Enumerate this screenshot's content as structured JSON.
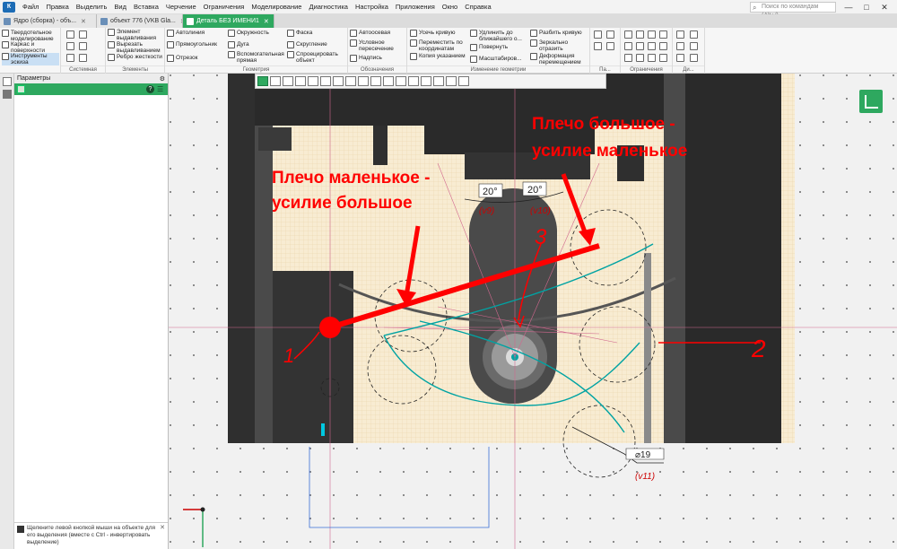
{
  "menubar": {
    "logo": "К",
    "items": [
      "Файл",
      "Правка",
      "Выделить",
      "Вид",
      "Вставка",
      "Черчение",
      "Ограничения",
      "Моделирование",
      "Диагностика",
      "Настройка",
      "Приложения",
      "Окно",
      "Справка"
    ],
    "search_placeholder": "Поиск по командам (Alt+/)",
    "window_buttons": [
      "—",
      "□",
      "✕"
    ]
  },
  "tabs": [
    {
      "label": "Ядро (сборка) - объ...",
      "close": "✕",
      "active": false
    },
    {
      "label": "объект 776 (VKB Gla...",
      "close": "✕",
      "active": false
    },
    {
      "label": "Деталь БЕЗ ИМЕНИ1",
      "close": "✕",
      "active": true
    }
  ],
  "ribbon": {
    "system": {
      "items": [
        "Твердотельное моделирование",
        "Каркас и поверхности",
        "Инструменты эскиза"
      ],
      "caption": "Системная"
    },
    "elements": {
      "items": [
        "Элемент выдавливания",
        "Вырезать выдавливанием",
        "Ребро жесткости"
      ],
      "caption": "Элементы"
    },
    "geometry": {
      "items": [
        "Автолиния",
        "Прямоугольник",
        "Отрезок",
        "Окружность",
        "Дуга",
        "Вспомогательная прямая",
        "Фаска",
        "Скругление",
        "Спроецировать объект"
      ],
      "caption": "Геометрия"
    },
    "annotation": {
      "items": [
        "Автоосевая",
        "Условное пересечение",
        "Надпись"
      ],
      "caption": "Обозначения"
    },
    "change": {
      "items": [
        "Усечь кривую",
        "Переместить по координатам",
        "Копия указанием",
        "Удлинить до ближайшего о...",
        "Повернуть",
        "Масштабиров...",
        "Разбить кривую",
        "Зеркально отразить",
        "Деформация перемещением"
      ],
      "caption": "Изменение геометрии"
    },
    "pa_caption": "Па...",
    "constraint_caption": "Ограничения",
    "dim_caption": "Ди..."
  },
  "panel": {
    "title": "Параметры",
    "hint": "Щелкните левой кнопкой мыши на объекте для его выделения (вместе с Ctrl - инвертировать выделение)"
  },
  "drawing": {
    "annotation_left": "Плечо маленькое - усилие большое",
    "annotation_left_line1": "Плечо маленькое -",
    "annotation_left_line2": "усилие большое",
    "annotation_right_line1": "Плечо большое -",
    "annotation_right_line2": "усилие маленькое",
    "angle1": "20°",
    "angle1_var": "(v9)",
    "angle2": "20°",
    "angle2_var": "(v10)",
    "diameter": "⌀19",
    "diameter_var": "(v11)",
    "mark_1": "1",
    "mark_2": "2",
    "mark_3": "3",
    "accent": "#ff0000",
    "sketch_color": "#00a3a3"
  }
}
